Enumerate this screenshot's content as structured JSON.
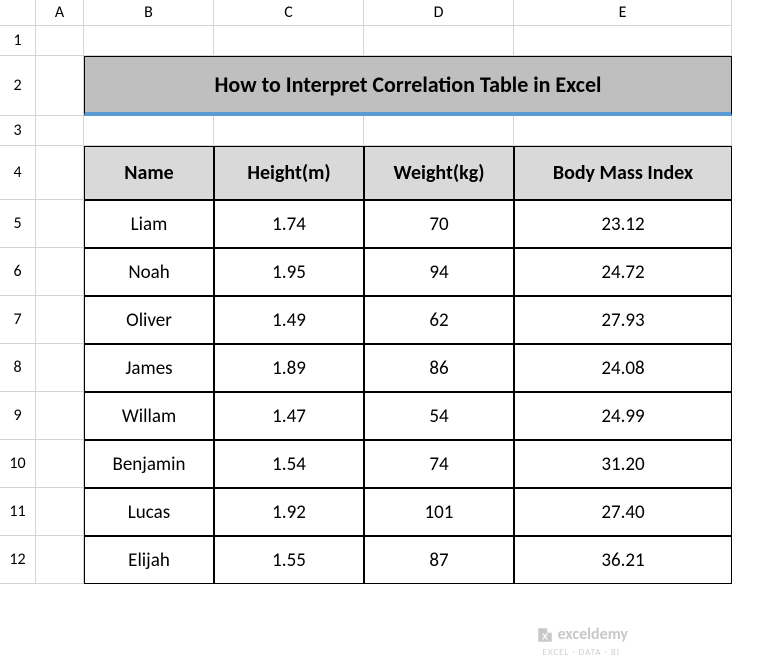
{
  "columns": [
    "A",
    "B",
    "C",
    "D",
    "E"
  ],
  "rows": [
    "1",
    "2",
    "3",
    "4",
    "5",
    "6",
    "7",
    "8",
    "9",
    "10",
    "11",
    "12"
  ],
  "title": "How to Interpret Correlation Table in Excel",
  "table": {
    "headers": [
      "Name",
      "Height(m)",
      "Weight(kg)",
      "Body Mass Index"
    ],
    "data": [
      [
        "Liam",
        "1.74",
        "70",
        "23.12"
      ],
      [
        "Noah",
        "1.95",
        "94",
        "24.72"
      ],
      [
        "Oliver",
        "1.49",
        "62",
        "27.93"
      ],
      [
        "James",
        "1.89",
        "86",
        "24.08"
      ],
      [
        "Willam",
        "1.47",
        "54",
        "24.99"
      ],
      [
        "Benjamin",
        "1.54",
        "74",
        "31.20"
      ],
      [
        "Lucas",
        "1.92",
        "101",
        "27.40"
      ],
      [
        "Elijah",
        "1.55",
        "87",
        "36.21"
      ]
    ]
  },
  "watermark": {
    "text": "exceldemy",
    "sub": "EXCEL · DATA · BI"
  }
}
